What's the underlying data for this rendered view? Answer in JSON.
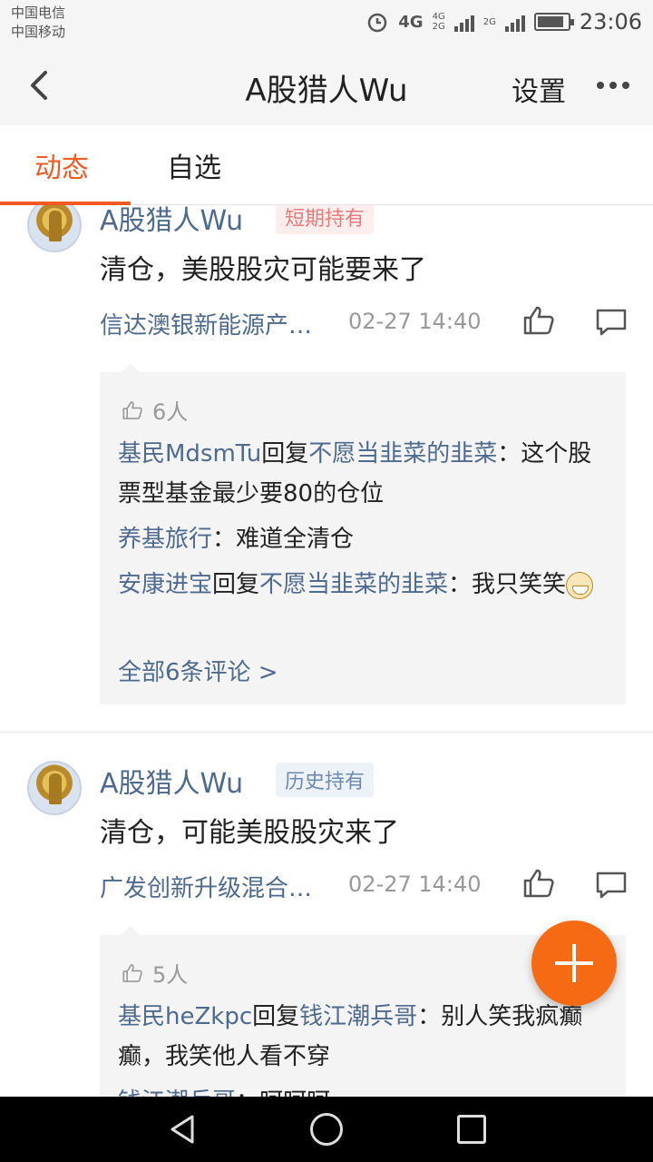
{
  "status_bar": {
    "carrier_1": "中国电信",
    "carrier_2": "中国移动",
    "network_1": "4G",
    "network_small_1": "4G",
    "network_small_2": "2G",
    "network_2": "2G",
    "time": "23:06"
  },
  "nav": {
    "title": "A股猎人Wu",
    "settings_label": "设置"
  },
  "tabs": [
    {
      "label": "动态",
      "active": true
    },
    {
      "label": "自选",
      "active": false
    }
  ],
  "posts": [
    {
      "author": "A股猎人Wu",
      "tag": "短期持有",
      "content": "清仓，美股股灾可能要来了",
      "fund": "信达澳银新能源产…",
      "time": "02-27 14:40",
      "likes": "6人",
      "comments": [
        {
          "user": "基民MdsmTu",
          "reply_word": "回复",
          "reply_to": "不愿当韭菜的韭菜",
          "text": "：这个股票型基金最少要80的仓位"
        },
        {
          "user": "养基旅行",
          "text": "：难道全清仓"
        },
        {
          "user": "安康进宝",
          "reply_word": "回复",
          "reply_to": "不愿当韭菜的韭菜",
          "text": "：我只笑笑"
        }
      ],
      "all_comments": "全部6条评论  >"
    },
    {
      "author": "A股猎人Wu",
      "tag": "历史持有",
      "content": "清仓，可能美股股灾来了",
      "fund": "广发创新升级混合…",
      "time": "02-27 14:40",
      "likes": "5人",
      "comments": [
        {
          "user": "基民heZkpc",
          "reply_word": "回复",
          "reply_to": "钱江潮兵哥",
          "text": "：别人笑我疯癫癫，我笑他人看不穿"
        },
        {
          "user": "钱江潮兵哥",
          "text": "：呵呵呵"
        }
      ]
    }
  ],
  "icons": [
    "back-icon",
    "more-icon",
    "like-icon",
    "comment-icon",
    "add-icon",
    "nav-back-icon",
    "nav-home-icon",
    "nav-recent-icon"
  ],
  "colors": {
    "accent": "#f15a22",
    "link": "#4e6a8e",
    "fab": "#f56a12"
  }
}
